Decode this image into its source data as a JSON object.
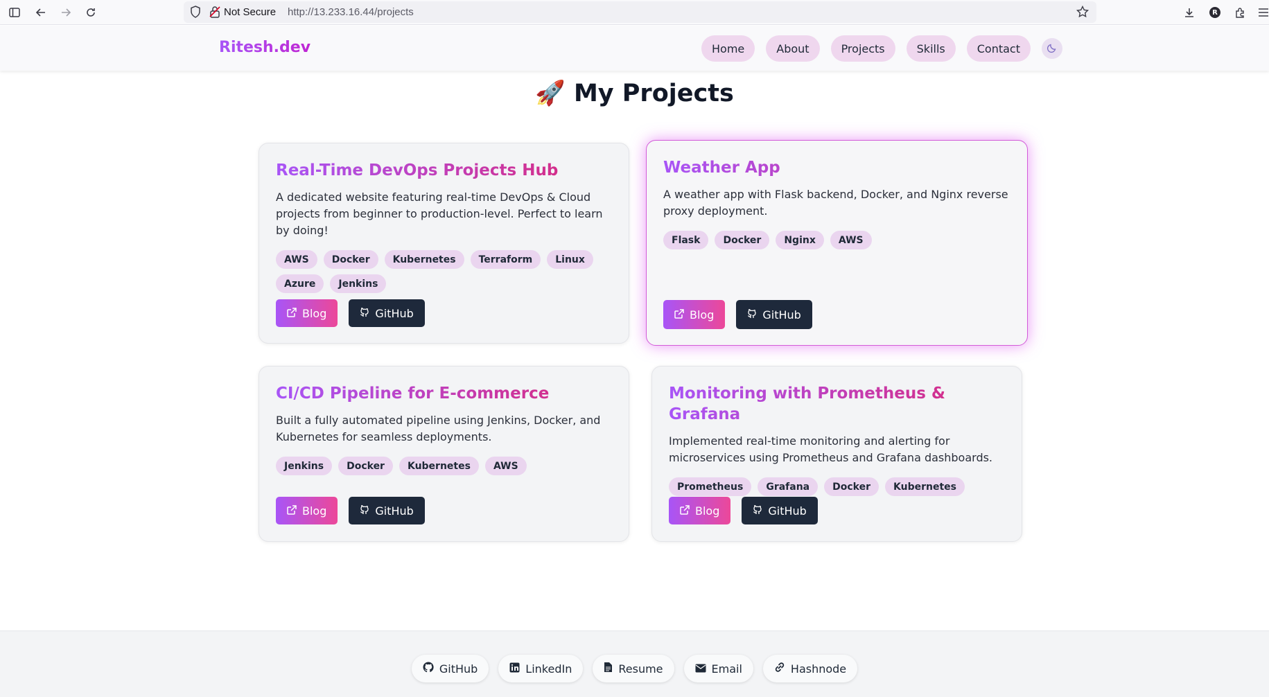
{
  "browser": {
    "security_label": "Not Secure",
    "url": "http://13.233.16.44/projects",
    "profile_initial": "R"
  },
  "navbar": {
    "brand": "Ritesh.dev",
    "links": [
      {
        "label": "Home"
      },
      {
        "label": "About"
      },
      {
        "label": "Projects"
      },
      {
        "label": "Skills"
      },
      {
        "label": "Contact"
      }
    ],
    "theme_icon": "moon-icon"
  },
  "page": {
    "title": "🚀 My Projects"
  },
  "projects": [
    {
      "title": "Real-Time DevOps Projects Hub",
      "description": "A dedicated website featuring real-time DevOps & Cloud projects from beginner to production-level. Perfect to learn by doing!",
      "tags": [
        "AWS",
        "Docker",
        "Kubernetes",
        "Terraform",
        "Linux",
        "Azure",
        "Jenkins"
      ],
      "blog_label": "Blog",
      "github_label": "GitHub"
    },
    {
      "title": "Weather App",
      "description": "A weather app with Flask backend, Docker, and Nginx reverse proxy deployment.",
      "tags": [
        "Flask",
        "Docker",
        "Nginx",
        "AWS"
      ],
      "blog_label": "Blog",
      "github_label": "GitHub"
    },
    {
      "title": "CI/CD Pipeline for E-commerce",
      "description": "Built a fully automated pipeline using Jenkins, Docker, and Kubernetes for seamless deployments.",
      "tags": [
        "Jenkins",
        "Docker",
        "Kubernetes",
        "AWS"
      ],
      "blog_label": "Blog",
      "github_label": "GitHub"
    },
    {
      "title": "Monitoring with Prometheus & Grafana",
      "description": "Implemented real-time monitoring and alerting for microservices using Prometheus and Grafana dashboards.",
      "tags": [
        "Prometheus",
        "Grafana",
        "Docker",
        "Kubernetes"
      ],
      "blog_label": "Blog",
      "github_label": "GitHub"
    }
  ],
  "footer": {
    "links": [
      {
        "label": "GitHub",
        "icon": "github-icon"
      },
      {
        "label": "LinkedIn",
        "icon": "linkedin-icon"
      },
      {
        "label": "Resume",
        "icon": "document-icon"
      },
      {
        "label": "Email",
        "icon": "envelope-icon"
      },
      {
        "label": "Hashnode",
        "icon": "link-icon"
      }
    ]
  },
  "colors": {
    "accent_purple": "#a855f7",
    "accent_pink": "#ec4899",
    "dark_button": "#1e293b",
    "tag_bg": "#ead5ef"
  }
}
